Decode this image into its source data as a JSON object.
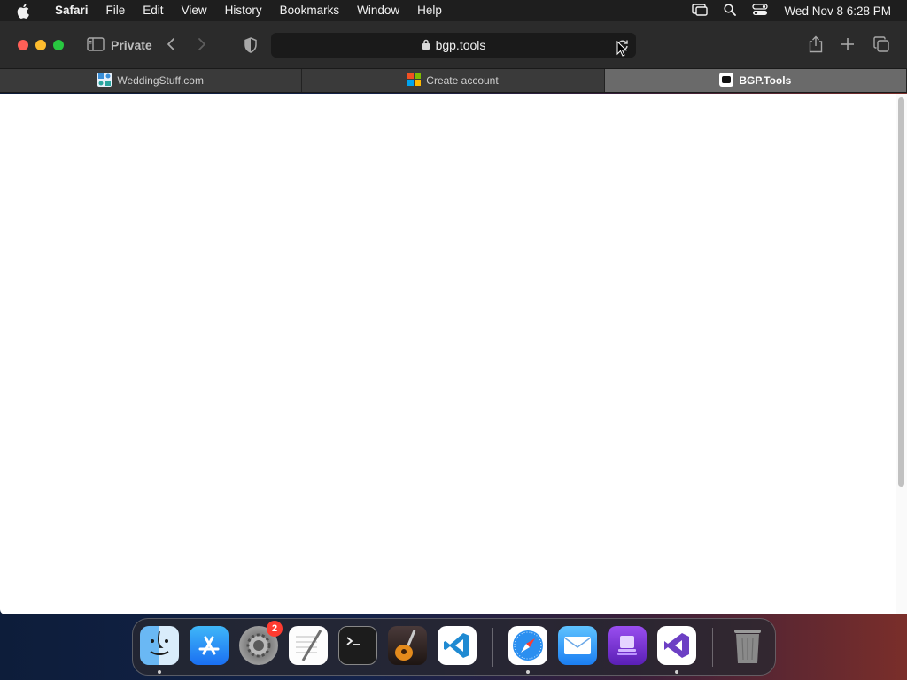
{
  "menubar": {
    "app_name": "Safari",
    "items": [
      "File",
      "Edit",
      "View",
      "History",
      "Bookmarks",
      "Window",
      "Help"
    ],
    "clock": "Wed Nov 8  6:28 PM"
  },
  "toolbar": {
    "private_label": "Private",
    "address": "bgp.tools"
  },
  "tabs": [
    {
      "title": "WeddingStuff.com",
      "active": false
    },
    {
      "title": "Create account",
      "active": false
    },
    {
      "title": "BGP.Tools",
      "active": true
    }
  ],
  "dock": {
    "apps": [
      {
        "name": "Finder",
        "icon": "finder-icon",
        "running": true
      },
      {
        "name": "App Store",
        "icon": "app-store-icon",
        "running": false
      },
      {
        "name": "System Settings",
        "icon": "system-settings-icon",
        "running": false,
        "badge": "2"
      },
      {
        "name": "TextEdit",
        "icon": "textedit-icon",
        "running": false
      },
      {
        "name": "Terminal",
        "icon": "terminal-icon",
        "running": false
      },
      {
        "name": "GarageBand",
        "icon": "garageband-icon",
        "running": false
      },
      {
        "name": "Visual Studio Code",
        "icon": "vscode-icon",
        "running": false
      },
      {
        "name": "Safari",
        "icon": "safari-icon",
        "running": true
      },
      {
        "name": "Mail",
        "icon": "mail-icon",
        "running": false
      },
      {
        "name": "Apple Configurator",
        "icon": "configurator-icon",
        "running": false
      },
      {
        "name": "Visual Studio",
        "icon": "visual-studio-icon",
        "running": true
      },
      {
        "name": "Trash",
        "icon": "trash-icon",
        "running": false
      }
    ]
  },
  "colors": {
    "close": "#ff5f57",
    "minimize": "#febc2e",
    "zoom": "#28c840",
    "badge": "#ff3b30",
    "active_tab": "#6a6a6a"
  }
}
